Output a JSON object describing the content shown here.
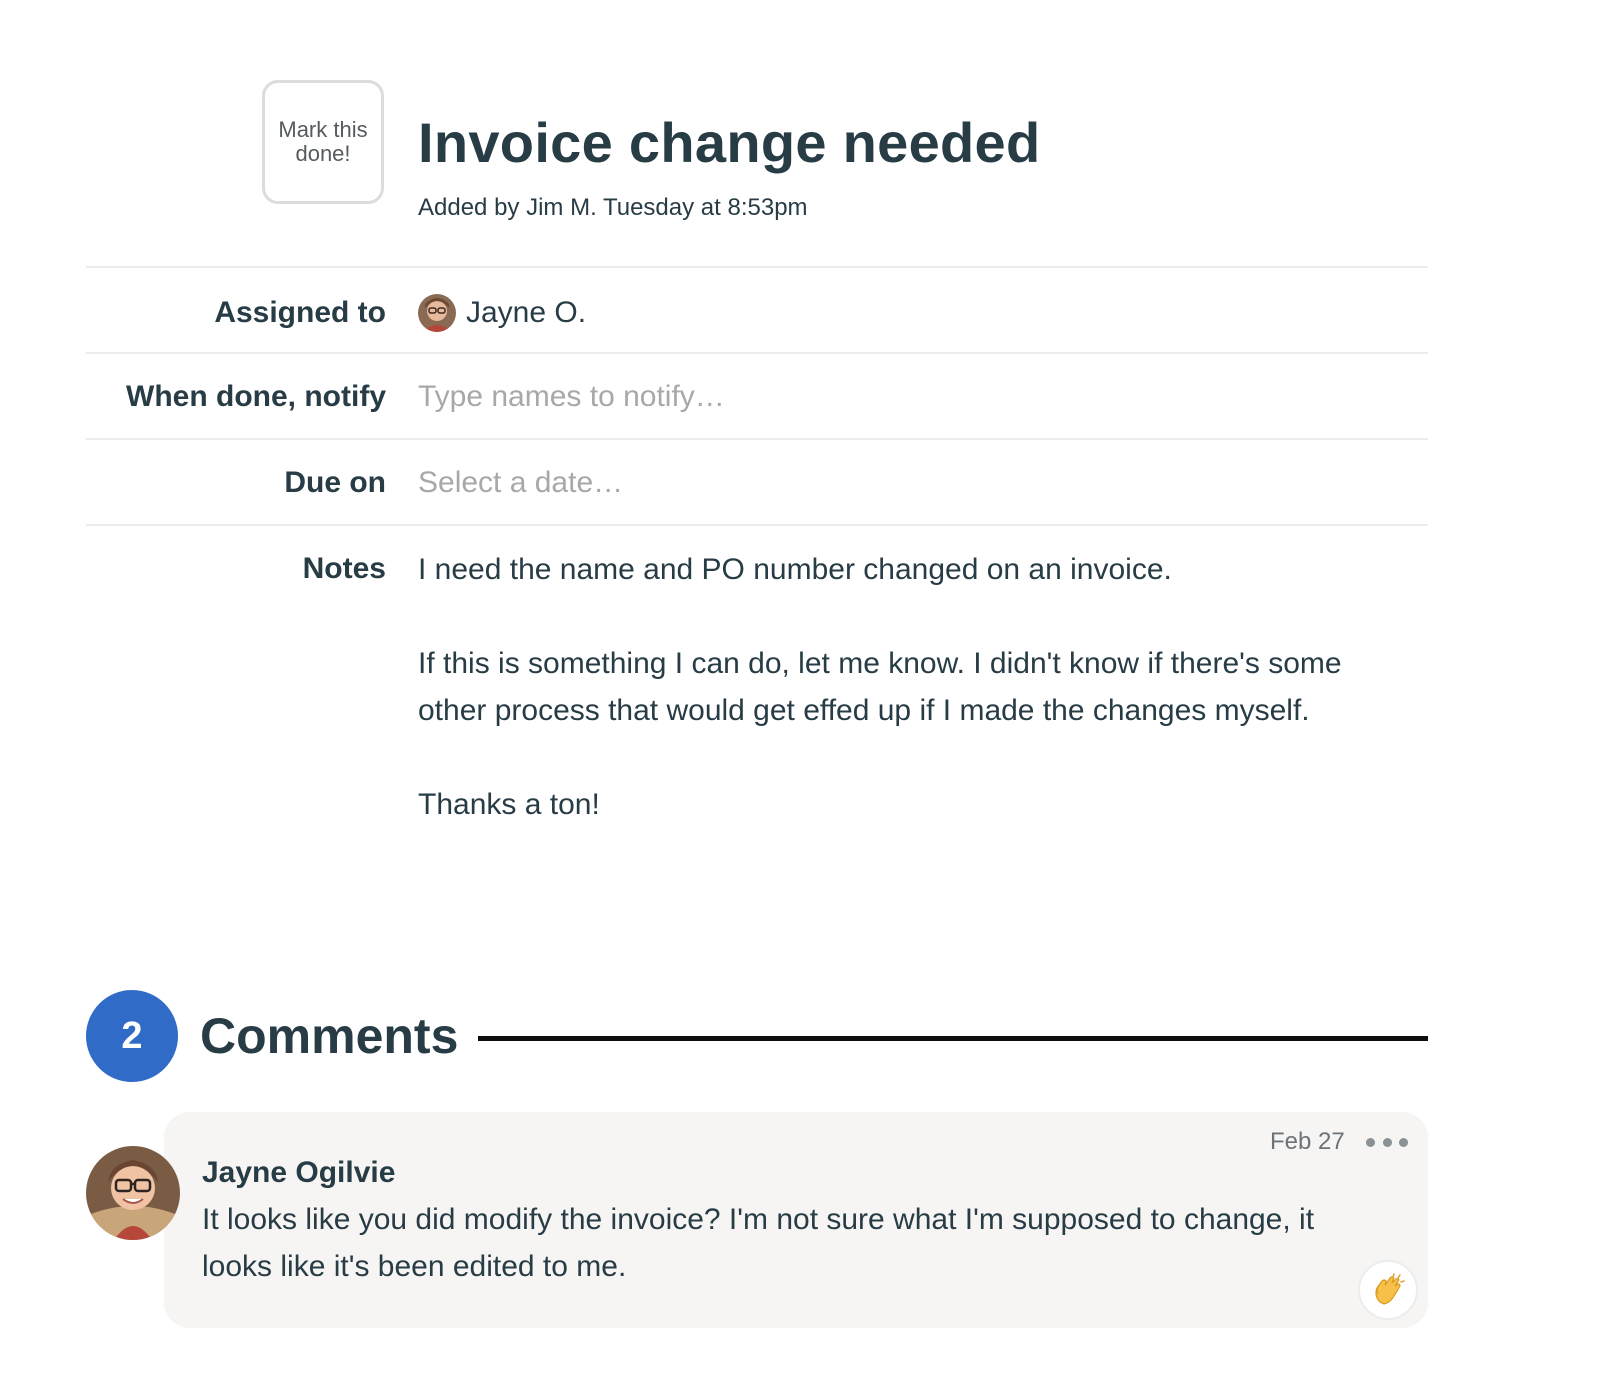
{
  "todo": {
    "mark_done_label": "Mark this done!",
    "title": "Invoice change needed",
    "added_by": "Added by Jim M. Tuesday at 8:53pm"
  },
  "fields": {
    "assigned_label": "Assigned to",
    "assignee_name": "Jayne O.",
    "notify_label": "When done, notify",
    "notify_placeholder": "Type names to notify…",
    "due_label": "Due on",
    "due_placeholder": "Select a date…",
    "notes_label": "Notes",
    "notes": [
      "I need the name and PO number changed on an invoice.",
      "If this is something I can do, let me know. I didn't know if there's some other process that would get effed up if I made the changes myself.",
      "Thanks a ton!"
    ]
  },
  "comments": {
    "count": "2",
    "heading": "Comments",
    "badge_color": "#2f6bc7",
    "items": [
      {
        "author": "Jayne Ogilvie",
        "date": "Feb 27",
        "body": "It looks like you did modify the invoice? I'm not sure what I'm supposed to change, it looks like it's been edited to me.",
        "boost_icon": "clapping-hands-icon"
      }
    ]
  }
}
